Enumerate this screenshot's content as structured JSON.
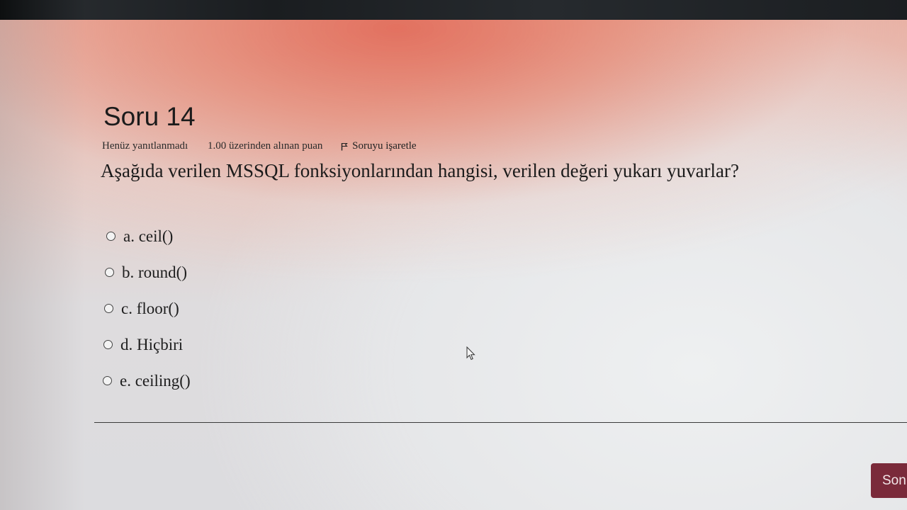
{
  "question": {
    "title": "Soru 14",
    "state": "Henüz yanıtlanmadı",
    "grade": "1.00 üzerinden alınan puan",
    "flag_label": "Soruyu işaretle",
    "text": "Aşağıda verilen MSSQL fonksiyonlarından hangisi, verilen değeri yukarı yuvarlar?",
    "answers": [
      {
        "label": "a. ceil()",
        "selected": false
      },
      {
        "label": "b. round()",
        "selected": false
      },
      {
        "label": "c. floor()",
        "selected": false
      },
      {
        "label": "d. Hiçbiri",
        "selected": false
      },
      {
        "label": "e. ceiling()",
        "selected": false
      }
    ]
  },
  "navigation": {
    "next_label": "Son"
  },
  "icons": {
    "flag": "flag-icon",
    "cursor": "mouse-pointer-icon"
  },
  "colors": {
    "button": "#7a2a3a",
    "text": "#1b1b1b"
  }
}
